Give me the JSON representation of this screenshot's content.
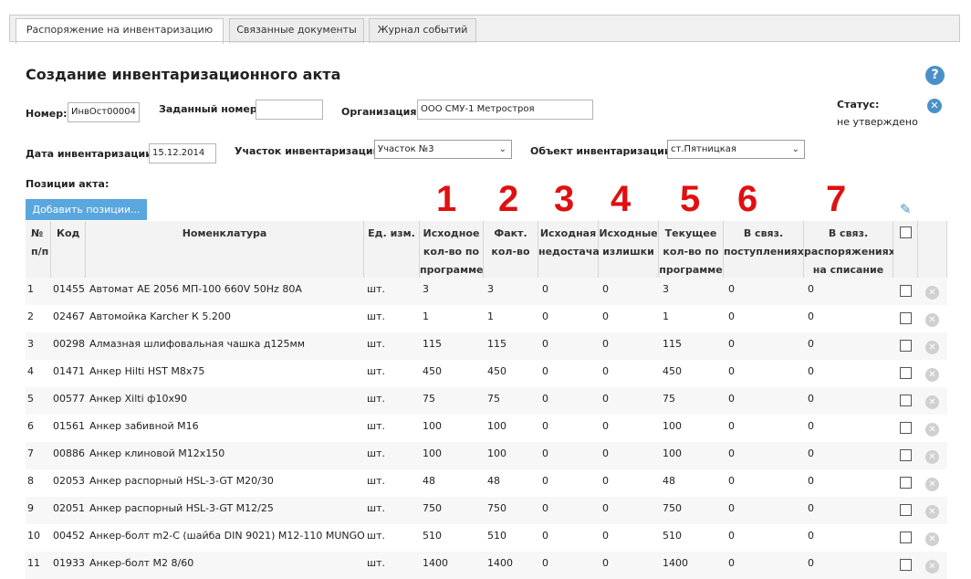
{
  "tabs": [
    {
      "label": "Распоряжение на инвентаризацию",
      "active": true
    },
    {
      "label": "Связанные документы",
      "active": false
    },
    {
      "label": "Журнал событий",
      "active": false
    }
  ],
  "title": "Создание инвентаризационного акта",
  "form": {
    "number_label": "Номер:",
    "number_value": "ИнвОст00004",
    "assigned_label": "Заданный номер:",
    "assigned_value": "",
    "org_label": "Организация:",
    "org_value": "ООО СМУ-1 Метростроя",
    "status_label": "Статус:",
    "status_value": "не утверждено",
    "date_label": "Дата инвентаризации:",
    "date_value": "15.12.2014",
    "section_label": "Участок инвентаризации:",
    "section_value": "Участок №3",
    "object_label": "Объект инвентаризации:",
    "object_value": "ст.Пятницкая",
    "positions_label": "Позиции акта:"
  },
  "add_button": "Добавить позиции...",
  "annotations": [
    "1",
    "2",
    "3",
    "4",
    "5",
    "6",
    "7"
  ],
  "icons": {
    "help": "help-icon",
    "close": "close-icon",
    "edit": "pencil-icon",
    "delete": "delete-icon"
  },
  "table": {
    "headers": {
      "num": [
        "№",
        "п/п"
      ],
      "code": "Код",
      "name": "Номенклатура",
      "unit": "Ед. изм.",
      "src_qty": [
        "Исходное",
        "кол-во по",
        "программе"
      ],
      "fact_qty": [
        "Факт.",
        "кол-во"
      ],
      "src_short": [
        "Исходная",
        "недостача"
      ],
      "src_surplus": [
        "Исходные",
        "излишки"
      ],
      "cur_qty": [
        "Текущее",
        "кол-во по",
        "программе"
      ],
      "linked_in": [
        "В связ.",
        "поступлениях"
      ],
      "linked_out": [
        "В связ.",
        "распоряжениях",
        "на списание"
      ]
    },
    "rows": [
      {
        "n": "1",
        "code": "01455",
        "name": "Автомат АЕ 2056 МП-100 660V 50Hz 80A",
        "unit": "шт.",
        "src": "3",
        "fact": "3",
        "short": "0",
        "surplus": "0",
        "cur": "3",
        "in": "0",
        "out": "0"
      },
      {
        "n": "2",
        "code": "02467",
        "name": "Автомойка Karcher К 5.200",
        "unit": "шт.",
        "src": "1",
        "fact": "1",
        "short": "0",
        "surplus": "0",
        "cur": "1",
        "in": "0",
        "out": "0"
      },
      {
        "n": "3",
        "code": "00298",
        "name": "Алмазная шлифовальная чашка д125мм",
        "unit": "шт.",
        "src": "115",
        "fact": "115",
        "short": "0",
        "surplus": "0",
        "cur": "115",
        "in": "0",
        "out": "0"
      },
      {
        "n": "4",
        "code": "01471",
        "name": "Анкер Hilti HST M8x75",
        "unit": "шт.",
        "src": "450",
        "fact": "450",
        "short": "0",
        "surplus": "0",
        "cur": "450",
        "in": "0",
        "out": "0"
      },
      {
        "n": "5",
        "code": "00577",
        "name": "Анкер Xilti ф10х90",
        "unit": "шт.",
        "src": "75",
        "fact": "75",
        "short": "0",
        "surplus": "0",
        "cur": "75",
        "in": "0",
        "out": "0"
      },
      {
        "n": "6",
        "code": "01561",
        "name": "Анкер забивной М16",
        "unit": "шт.",
        "src": "100",
        "fact": "100",
        "short": "0",
        "surplus": "0",
        "cur": "100",
        "in": "0",
        "out": "0"
      },
      {
        "n": "7",
        "code": "00886",
        "name": "Анкер клиновой М12х150",
        "unit": "шт.",
        "src": "100",
        "fact": "100",
        "short": "0",
        "surplus": "0",
        "cur": "100",
        "in": "0",
        "out": "0"
      },
      {
        "n": "8",
        "code": "02053",
        "name": "Анкер распорный HSL-3-GT M20/30",
        "unit": "шт.",
        "src": "48",
        "fact": "48",
        "short": "0",
        "surplus": "0",
        "cur": "48",
        "in": "0",
        "out": "0"
      },
      {
        "n": "9",
        "code": "02051",
        "name": "Анкер распорный HSL-3-GT M12/25",
        "unit": "шт.",
        "src": "750",
        "fact": "750",
        "short": "0",
        "surplus": "0",
        "cur": "750",
        "in": "0",
        "out": "0"
      },
      {
        "n": "10",
        "code": "00452",
        "name": "Анкер-болт m2-C (шайба DIN 9021) M12-110 MUNGO",
        "unit": "шт.",
        "src": "510",
        "fact": "510",
        "short": "0",
        "surplus": "0",
        "cur": "510",
        "in": "0",
        "out": "0"
      },
      {
        "n": "11",
        "code": "01933",
        "name": "Анкер-болт M2 8/60",
        "unit": "шт.",
        "src": "1400",
        "fact": "1400",
        "short": "0",
        "surplus": "0",
        "cur": "1400",
        "in": "0",
        "out": "0"
      }
    ]
  }
}
